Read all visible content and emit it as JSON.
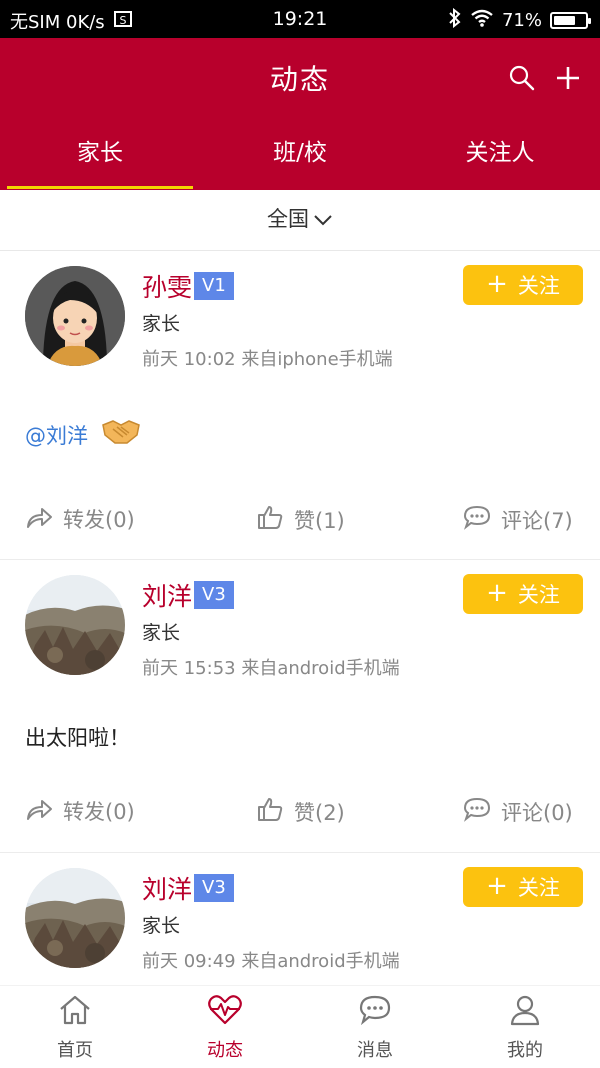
{
  "status_bar": {
    "carrier": "无SIM 0K/s",
    "time": "19:21",
    "battery": "71%",
    "battery_level": 0.71
  },
  "header": {
    "title": "动态",
    "tabs": [
      {
        "label": "家长",
        "active": true
      },
      {
        "label": "班/校",
        "active": false
      },
      {
        "label": "关注人",
        "active": false
      }
    ]
  },
  "filter": {
    "region": "全国"
  },
  "posts": [
    {
      "name": "孙雯",
      "badge": "V1",
      "role": "家长",
      "meta": "前天 10:02 来自iphone手机端",
      "follow_label": "关注",
      "mention": "@刘洋",
      "content": "",
      "emoji": "handshake-emoji",
      "actions": {
        "share": "转发(0)",
        "like": "赞(1)",
        "comment": "评论(7)"
      }
    },
    {
      "name": "刘洋",
      "badge": "V3",
      "role": "家长",
      "meta": "前天 15:53 来自android手机端",
      "follow_label": "关注",
      "content": "出太阳啦！",
      "actions": {
        "share": "转发(0)",
        "like": "赞(2)",
        "comment": "评论(0)"
      }
    },
    {
      "name": "刘洋",
      "badge": "V3",
      "role": "家长",
      "meta": "前天 09:49 来自android手机端",
      "follow_label": "关注"
    }
  ],
  "bottom_nav": [
    {
      "label": "首页",
      "icon": "home-icon",
      "active": false
    },
    {
      "label": "动态",
      "icon": "heartbeat-icon",
      "active": true
    },
    {
      "label": "消息",
      "icon": "chat-icon",
      "active": false
    },
    {
      "label": "我的",
      "icon": "person-icon",
      "active": false
    }
  ],
  "colors": {
    "brand": "#b8002c",
    "follow_button": "#fcc20f",
    "badge": "#5e87e8",
    "tab_indicator": "#f2d600",
    "mention": "#3a7bd5"
  }
}
